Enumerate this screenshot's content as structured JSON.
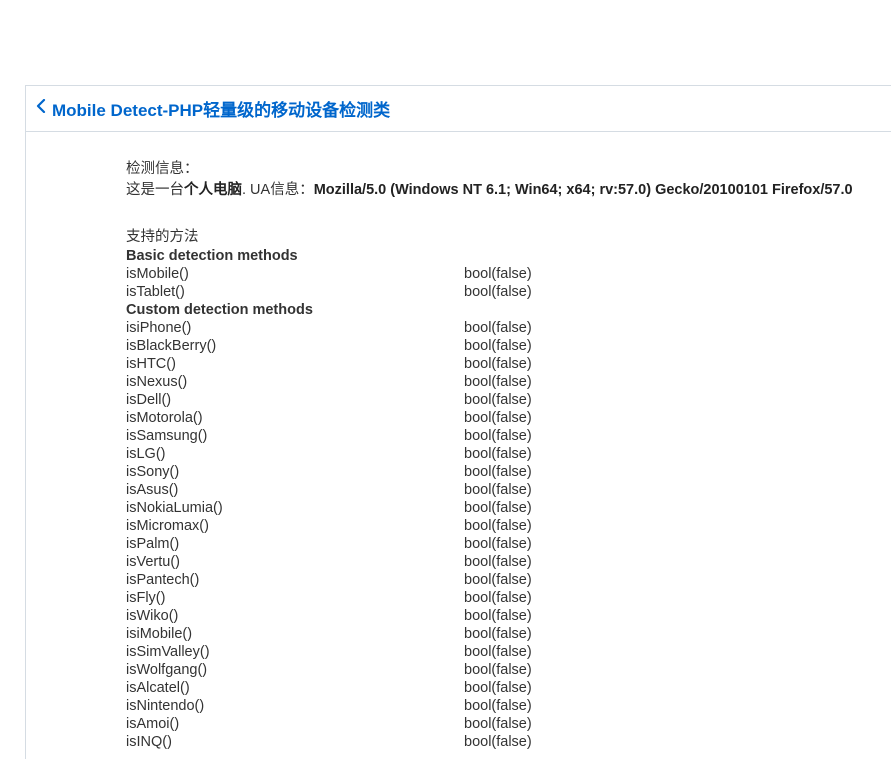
{
  "header": {
    "title": "Mobile Detect-PHP轻量级的移动设备检测类"
  },
  "info": {
    "label": "检测信息：",
    "device_prefix": "这是一台",
    "device_type": "个人电脑",
    "ua_label": ". UA信息：",
    "ua_string": "Mozilla/5.0 (Windows NT 6.1; Win64; x64; rv:57.0) Gecko/20100101 Firefox/57.0"
  },
  "supported_methods_label": "支持的方法",
  "groups": [
    {
      "title": "Basic detection methods",
      "rows": [
        {
          "method": "isMobile()",
          "result": "bool(false)"
        },
        {
          "method": "isTablet()",
          "result": "bool(false)"
        }
      ]
    },
    {
      "title": "Custom detection methods",
      "rows": [
        {
          "method": "isiPhone()",
          "result": "bool(false)"
        },
        {
          "method": "isBlackBerry()",
          "result": "bool(false)"
        },
        {
          "method": "isHTC()",
          "result": "bool(false)"
        },
        {
          "method": "isNexus()",
          "result": "bool(false)"
        },
        {
          "method": "isDell()",
          "result": "bool(false)"
        },
        {
          "method": "isMotorola()",
          "result": "bool(false)"
        },
        {
          "method": "isSamsung()",
          "result": "bool(false)"
        },
        {
          "method": "isLG()",
          "result": "bool(false)"
        },
        {
          "method": "isSony()",
          "result": "bool(false)"
        },
        {
          "method": "isAsus()",
          "result": "bool(false)"
        },
        {
          "method": "isNokiaLumia()",
          "result": "bool(false)"
        },
        {
          "method": "isMicromax()",
          "result": "bool(false)"
        },
        {
          "method": "isPalm()",
          "result": "bool(false)"
        },
        {
          "method": "isVertu()",
          "result": "bool(false)"
        },
        {
          "method": "isPantech()",
          "result": "bool(false)"
        },
        {
          "method": "isFly()",
          "result": "bool(false)"
        },
        {
          "method": "isWiko()",
          "result": "bool(false)"
        },
        {
          "method": "isiMobile()",
          "result": "bool(false)"
        },
        {
          "method": "isSimValley()",
          "result": "bool(false)"
        },
        {
          "method": "isWolfgang()",
          "result": "bool(false)"
        },
        {
          "method": "isAlcatel()",
          "result": "bool(false)"
        },
        {
          "method": "isNintendo()",
          "result": "bool(false)"
        },
        {
          "method": "isAmoi()",
          "result": "bool(false)"
        },
        {
          "method": "isINQ()",
          "result": "bool(false)"
        }
      ]
    }
  ]
}
